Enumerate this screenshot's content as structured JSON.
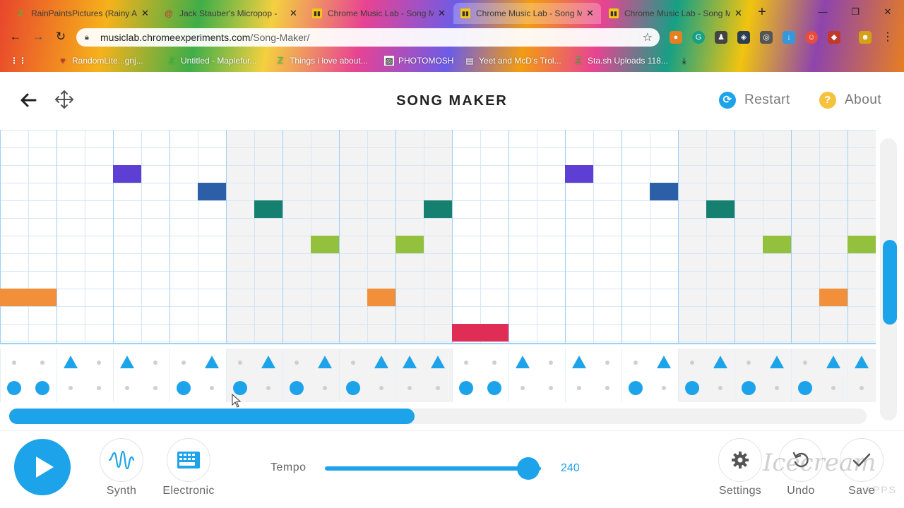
{
  "browser": {
    "tabs": [
      {
        "title": "RainPaintsPictures (Rainy A",
        "favicon": "deviantart-icon",
        "active": false
      },
      {
        "title": "Jack Stauber's Micropop -",
        "favicon": "scribble-icon",
        "active": false
      },
      {
        "title": "Chrome Music Lab - Song M",
        "favicon": "music-lab-icon",
        "active": false
      },
      {
        "title": "Chrome Music Lab - Song M",
        "favicon": "music-lab-icon",
        "active": true
      },
      {
        "title": "Chrome Music Lab - Song M",
        "favicon": "music-lab-icon",
        "active": false
      }
    ],
    "url_host": "musiclab.chromeexperiments.com",
    "url_path": "/Song-Maker/",
    "bookmarks": [
      {
        "label": "RandomLite...gnj...",
        "icon": "bookmark-red-icon"
      },
      {
        "label": "Untitled - Maplefur...",
        "icon": "deviantart-icon"
      },
      {
        "label": "Things i love about...",
        "icon": "deviantart-icon"
      },
      {
        "label": "PHOTOMOSH",
        "icon": "photomosh-icon"
      },
      {
        "label": "Yeet and McD's Trol...",
        "icon": "doc-icon"
      },
      {
        "label": "Sta.sh Uploads 118...",
        "icon": "deviantart-icon"
      }
    ]
  },
  "app": {
    "title": "SONG MAKER",
    "restart_label": "Restart",
    "about_label": "About",
    "restart_icon_glyph": "⟳",
    "about_icon_glyph": "?"
  },
  "grid": {
    "columns": 31,
    "melody_rows": 13,
    "notes": [
      {
        "col": 0,
        "row": 9,
        "len": 2,
        "color": "#f28f3b"
      },
      {
        "col": 4,
        "row": 2,
        "len": 1,
        "color": "#5e3fd3"
      },
      {
        "col": 7,
        "row": 3,
        "len": 1,
        "color": "#2d5ea8"
      },
      {
        "col": 9,
        "row": 4,
        "len": 1,
        "color": "#168070"
      },
      {
        "col": 11,
        "row": 6,
        "len": 1,
        "color": "#93c13d"
      },
      {
        "col": 13,
        "row": 9,
        "len": 1,
        "color": "#f28f3b"
      },
      {
        "col": 14,
        "row": 6,
        "len": 1,
        "color": "#93c13d"
      },
      {
        "col": 15,
        "row": 4,
        "len": 1,
        "color": "#168070"
      },
      {
        "col": 16,
        "row": 11,
        "len": 2,
        "color": "#e02d55"
      },
      {
        "col": 20,
        "row": 2,
        "len": 1,
        "color": "#5e3fd3"
      },
      {
        "col": 23,
        "row": 3,
        "len": 1,
        "color": "#2d5ea8"
      },
      {
        "col": 25,
        "row": 4,
        "len": 1,
        "color": "#168070"
      },
      {
        "col": 27,
        "row": 6,
        "len": 1,
        "color": "#93c13d"
      },
      {
        "col": 29,
        "row": 9,
        "len": 1,
        "color": "#f28f3b"
      },
      {
        "col": 30,
        "row": 6,
        "len": 1,
        "color": "#93c13d"
      }
    ],
    "triangles": [
      2,
      4,
      7,
      9,
      11,
      13,
      14,
      15,
      18,
      20,
      23,
      25,
      27,
      29,
      30
    ],
    "circles": [
      0,
      1,
      6,
      8,
      10,
      12,
      16,
      17,
      22,
      24,
      26,
      28
    ],
    "accent_color": "#1da3ea"
  },
  "controls": {
    "synth_label": "Synth",
    "electronic_label": "Electronic",
    "tempo_label": "Tempo",
    "tempo_value": "240",
    "tempo_fraction": 0.94,
    "settings_label": "Settings",
    "undo_label": "Undo",
    "save_label": "Save"
  },
  "watermark": {
    "brand": "Icecream",
    "sub": "APPS"
  }
}
